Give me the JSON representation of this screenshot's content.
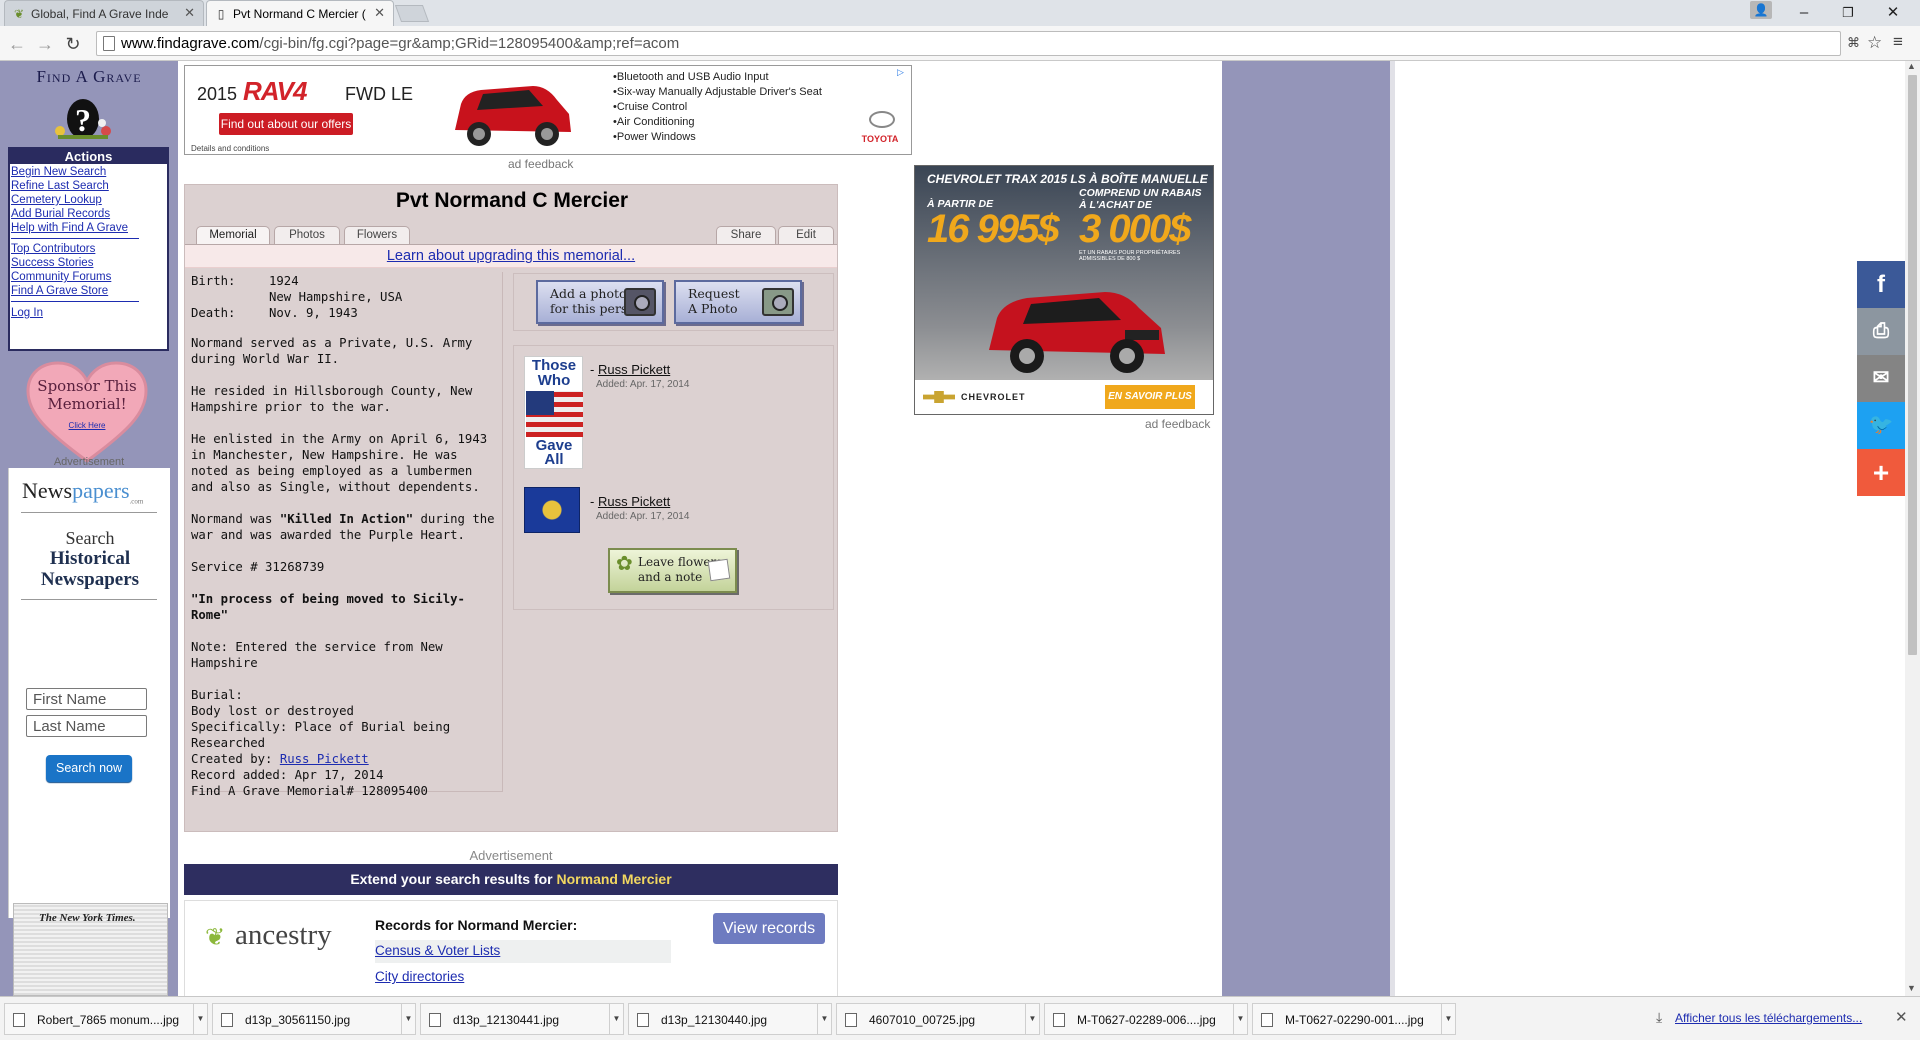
{
  "browser": {
    "tabs": [
      {
        "title": "Global, Find A Grave Inde",
        "icon": "ancestry-leaf-icon"
      },
      {
        "title": "Pvt Normand C Mercier (",
        "icon": "page-icon"
      }
    ],
    "url_host": "www.findagrave.com",
    "url_path": "/cgi-bin/fg.cgi?page=gr&amp;GRid=128095400&amp;ref=acom",
    "window_controls": {
      "minimize": "–",
      "restore": "❐",
      "close": "✕"
    }
  },
  "sidebar": {
    "logo_title": "Find A Grave",
    "actions_heading": "Actions",
    "links_group1": [
      "Begin New Search",
      "Refine Last Search",
      "Cemetery Lookup",
      "Add Burial Records",
      "Help with Find A Grave"
    ],
    "links_group2": [
      "Top Contributors",
      "Success Stories",
      "Community Forums",
      "Find A Grave Store"
    ],
    "login": "Log In",
    "sponsor_line1": "Sponsor This",
    "sponsor_line2": "Memorial!",
    "sponsor_click": "Click Here",
    "advertisement_label": "Advertisement",
    "newspapers": {
      "logo_news": "News",
      "logo_papers": "papers",
      "logo_suffix": ".com",
      "search": "Search",
      "historical_line1": "Historical",
      "historical_line2": "Newspapers",
      "first_name_placeholder": "First Name",
      "last_name_placeholder": "Last Name",
      "button": "Search now"
    },
    "nyt_caption": "The New York Times."
  },
  "top_ad": {
    "year": "2015",
    "model": "RAV4",
    "trim": "FWD LE",
    "cta": "Find out about our offers",
    "details": "Details and conditions",
    "features": [
      "Bluetooth and USB Audio Input",
      "Six-way Manually Adjustable Driver's Seat",
      "Cruise Control",
      "Air Conditioning",
      "Power Windows"
    ],
    "brand": "TOYOTA",
    "feedback": "ad feedback"
  },
  "memorial": {
    "title": "Pvt Normand C Mercier",
    "tabs": {
      "memorial": "Memorial",
      "photos": "Photos",
      "flowers": "Flowers",
      "share": "Share",
      "edit": "Edit"
    },
    "upgrade_link": "Learn about upgrading this memorial...",
    "birth_label": "Birth:",
    "birth_year": "1924",
    "birth_place": "New Hampshire, USA",
    "death_label": "Death:",
    "death_date": "Nov. 9, 1943",
    "bio_p1": "Normand served as a Private, U.S. Army during World War II.",
    "bio_p2": "He resided in Hillsborough County, New Hampshire prior to the war.",
    "bio_p3": "He enlisted in the Army on April 6, 1943 in Manchester, New Hampshire. He was noted as being employed as a lumbermen and also as Single, without dependents.",
    "bio_p4_pre": "Normand was ",
    "bio_p4_bold": "\"Killed In Action\"",
    "bio_p4_post": " during the war and was awarded the Purple Heart.",
    "service": "Service # 31268739",
    "process_note": "\"In process of being moved to Sicily-Rome\"",
    "note": "Note: Entered the service from New Hampshire",
    "burial_label": "Burial:",
    "burial_line1": "Body lost or destroyed",
    "burial_line2": "Specifically: Place of Burial being Researched",
    "created_by_label": "Created by: ",
    "created_by": "Russ Pickett",
    "record_added": "Record added: Apr 17, 2014",
    "memorial_id": "Find A Grave Memorial# 128095400",
    "add_photo_line1": "Add a photo",
    "add_photo_line2": "for this person",
    "request_photo_line1": "Request",
    "request_photo_line2": "A Photo",
    "flowers": [
      {
        "img_top": "Those Who",
        "img_bottom": "Gave All",
        "dash": "-",
        "name": "Russ Pickett",
        "added": "Added: Apr. 17, 2014"
      },
      {
        "dash": "-",
        "name": "Russ Pickett",
        "added": "Added: Apr. 17, 2014"
      }
    ],
    "leave_flowers_line1": "Leave flowers",
    "leave_flowers_line2": "and a note"
  },
  "right_ad": {
    "headline": "CHEVROLET TRAX 2015 LS À BOÎTE MANUELLE",
    "from": "À PARTIR DE",
    "price": "16 995$",
    "rebate_line1": "COMPREND UN RABAIS",
    "rebate_line2": "À L'ACHAT DE",
    "rebate": "3 000$",
    "fine_print": "ET UN RABAIS POUR PROPRIÉTAIRES ADMISSIBLES DE 800 $",
    "brand": "CHEVROLET",
    "cta": "EN SAVOIR PLUS »",
    "feedback": "ad feedback"
  },
  "ancestry": {
    "advertisement_label": "Advertisement",
    "extend_prefix": "Extend your search results for ",
    "extend_name": "Normand Mercier",
    "logo": "ancestry",
    "records_heading": "Records for Normand Mercier:",
    "links": [
      "Census & Voter Lists",
      "City directories"
    ],
    "button": "View records"
  },
  "social": [
    {
      "name": "facebook",
      "glyph": "f",
      "color": "#3b5998"
    },
    {
      "name": "print",
      "glyph": "⎙",
      "color": "#8c96a0"
    },
    {
      "name": "email",
      "glyph": "✉",
      "color": "#848484"
    },
    {
      "name": "twitter",
      "glyph": "🐦",
      "color": "#1da1f2"
    },
    {
      "name": "more",
      "glyph": "+",
      "color": "#f05a3c"
    }
  ],
  "downloads": {
    "items": [
      "Robert_7865 monum....jpg",
      "d13p_30561150.jpg",
      "d13p_12130441.jpg",
      "d13p_12130440.jpg",
      "4607010_00725.jpg",
      "M-T0627-02289-006....jpg",
      "M-T0627-02290-001....jpg"
    ],
    "show_all": "Afficher tous les téléchargements..."
  }
}
